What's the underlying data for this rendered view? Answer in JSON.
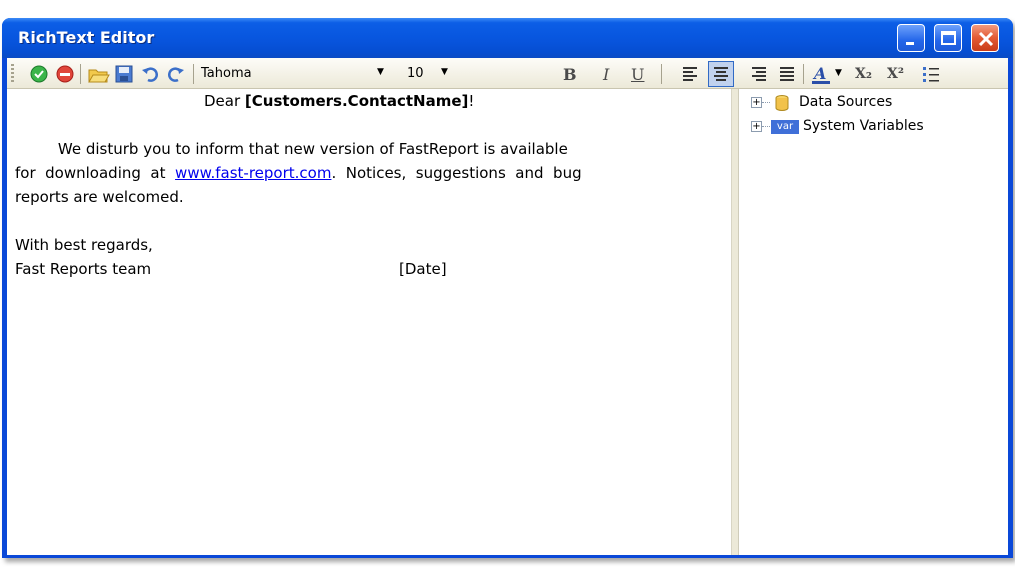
{
  "window": {
    "title": "RichText Editor"
  },
  "toolbar": {
    "font_name": "Tahoma",
    "font_size": "10",
    "bold_label": "B",
    "italic_label": "I",
    "underline_label": "U",
    "subscript_label": "X₂",
    "superscript_label": "X²",
    "active_alignment": "center"
  },
  "editor": {
    "greeting_prefix": "Dear ",
    "greeting_field": "[Customers.ContactName]",
    "greeting_suffix": "!",
    "body_line1": "         We disturb you to inform that new version of FastReport is available",
    "body_line2_a": "for  downloading  at  ",
    "body_link": "www.fast-report.com",
    "body_line2_b": ".  Notices,  suggestions  and  bug",
    "body_line3": "reports are welcomed.",
    "closing": "With best regards,",
    "signature": "Fast Reports team",
    "date_field": "[Date]",
    "link_color": "#0000ee"
  },
  "tree": {
    "items": [
      {
        "label": "Data Sources",
        "icon": "database-icon",
        "expander": "+"
      },
      {
        "label": "System Variables",
        "icon": "var-icon",
        "icon_text": "var",
        "expander": "+"
      }
    ]
  },
  "colors": {
    "titlebar": "#0856df",
    "close_button": "#e35a34",
    "toolbar_bg": "#ece9d8"
  }
}
